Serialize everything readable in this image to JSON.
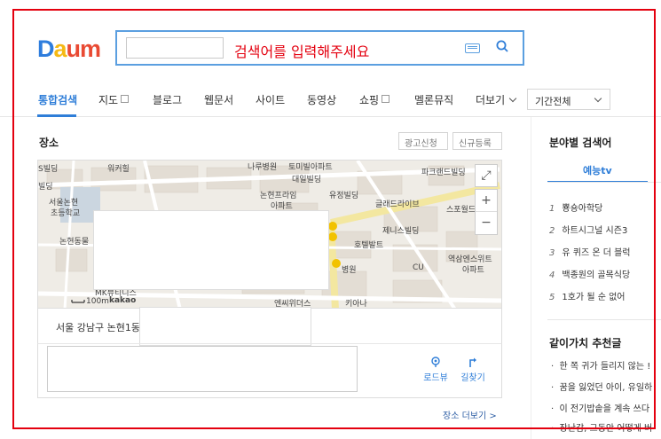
{
  "header": {
    "logo": {
      "d": "D",
      "a": "a",
      "u": "u",
      "m": "m"
    },
    "search_hint": "검색어를 입력해주세요",
    "search_value": ""
  },
  "tabs": {
    "items": [
      "통합검색",
      "지도",
      "블로그",
      "웹문서",
      "사이트",
      "동영상",
      "쇼핑",
      "멜론뮤직",
      "더보기"
    ],
    "period": "기간전체"
  },
  "place": {
    "title": "장소",
    "ad_button": "광고신청",
    "register_button": "신규등록",
    "map_labels": [
      "워커힐",
      "나루병원",
      "토미빌아파트",
      "대일빌딩",
      "파크랜드빌딩",
      "논현프라임",
      "아파트",
      "유정빌딩",
      "글래드라이브",
      "스포월드",
      "서울논현",
      "초등학교",
      "논현동물",
      "제니스빌딩",
      "호텔발트",
      "병원",
      "역삼엔스위트",
      "아파트",
      "CU",
      "엔씨위더스",
      "키아나",
      "MK뷰티니스",
      "kakao",
      "100m",
      "S빌딩",
      "빌딩"
    ],
    "address": "서울 강남구 논현1동",
    "roadview_label": "로드뷰",
    "directions_label": "길찾기",
    "more_link": "장소 더보기 >"
  },
  "rightcol": {
    "title": "분야별 검색어",
    "tab": "예능tv",
    "ranks": [
      {
        "n": "1",
        "text": "뿅숑아학당"
      },
      {
        "n": "2",
        "text": "하트시그널 시즌3"
      },
      {
        "n": "3",
        "text": "유 퀴즈 온 더 블럭"
      },
      {
        "n": "4",
        "text": "백종원의 골목식당"
      },
      {
        "n": "5",
        "text": "1호가 될 순 없어"
      }
    ],
    "rec_title": "같이가치 추천글",
    "recs": [
      "한 쪽 귀가 들리지 않는 !",
      "꿈을 잃었던 아이, 유일하",
      "이 전기밥솥을 계속 쓰다",
      "장난감, 그동안 어떻게 버"
    ]
  }
}
